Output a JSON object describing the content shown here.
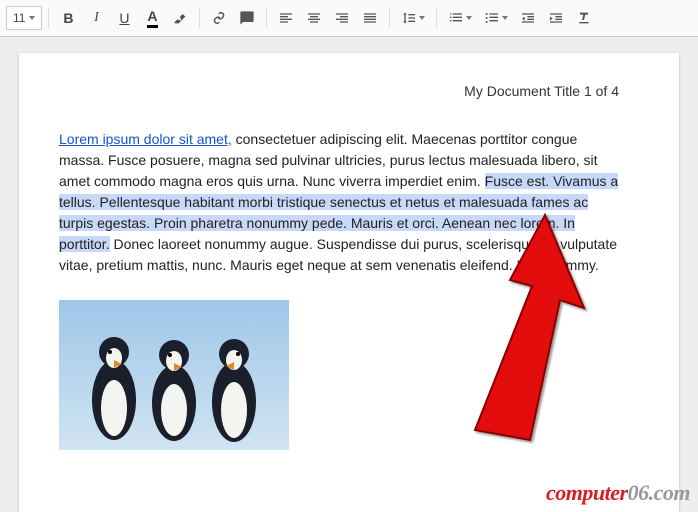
{
  "toolbar": {
    "font_size": "11"
  },
  "header": {
    "title_line": "My Document Title 1 of 4"
  },
  "body": {
    "link_text": "Lorem ipsum dolor sit amet,",
    "pre_highlight": " consectetuer adipiscing elit. Maecenas porttitor congue massa. Fusce posuere, magna sed pulvinar ultricies, purus lectus malesuada libero, sit amet commodo magna eros quis urna. Nunc viverra imperdiet enim. ",
    "highlight": "Fusce est. Vivamus a tellus. Pellentesque habitant morbi tristique senectus et netus et malesuada fames ac turpis egestas. Proin pharetra nonummy pede. Mauris et orci. Aenean nec lorem. In porttitor.",
    "post_highlight": " Donec laoreet nonummy augue. Suspendisse dui purus, scelerisque at, vulputate vitae, pretium mattis, nunc. Mauris eget neque at sem venenatis eleifend. Ut nonummy."
  },
  "watermark": {
    "text_red": "computer",
    "text_gray": "06.com"
  }
}
